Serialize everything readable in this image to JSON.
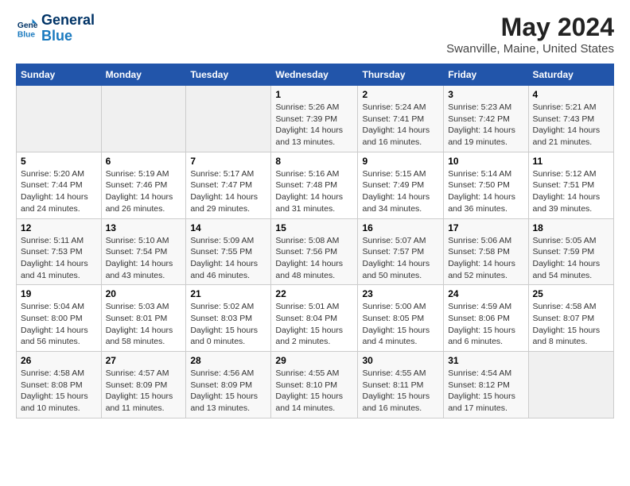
{
  "header": {
    "logo_line1": "General",
    "logo_line2": "Blue",
    "title": "May 2024",
    "subtitle": "Swanville, Maine, United States"
  },
  "columns": [
    "Sunday",
    "Monday",
    "Tuesday",
    "Wednesday",
    "Thursday",
    "Friday",
    "Saturday"
  ],
  "weeks": [
    [
      {
        "day": "",
        "info": ""
      },
      {
        "day": "",
        "info": ""
      },
      {
        "day": "",
        "info": ""
      },
      {
        "day": "1",
        "info": "Sunrise: 5:26 AM\nSunset: 7:39 PM\nDaylight: 14 hours\nand 13 minutes."
      },
      {
        "day": "2",
        "info": "Sunrise: 5:24 AM\nSunset: 7:41 PM\nDaylight: 14 hours\nand 16 minutes."
      },
      {
        "day": "3",
        "info": "Sunrise: 5:23 AM\nSunset: 7:42 PM\nDaylight: 14 hours\nand 19 minutes."
      },
      {
        "day": "4",
        "info": "Sunrise: 5:21 AM\nSunset: 7:43 PM\nDaylight: 14 hours\nand 21 minutes."
      }
    ],
    [
      {
        "day": "5",
        "info": "Sunrise: 5:20 AM\nSunset: 7:44 PM\nDaylight: 14 hours\nand 24 minutes."
      },
      {
        "day": "6",
        "info": "Sunrise: 5:19 AM\nSunset: 7:46 PM\nDaylight: 14 hours\nand 26 minutes."
      },
      {
        "day": "7",
        "info": "Sunrise: 5:17 AM\nSunset: 7:47 PM\nDaylight: 14 hours\nand 29 minutes."
      },
      {
        "day": "8",
        "info": "Sunrise: 5:16 AM\nSunset: 7:48 PM\nDaylight: 14 hours\nand 31 minutes."
      },
      {
        "day": "9",
        "info": "Sunrise: 5:15 AM\nSunset: 7:49 PM\nDaylight: 14 hours\nand 34 minutes."
      },
      {
        "day": "10",
        "info": "Sunrise: 5:14 AM\nSunset: 7:50 PM\nDaylight: 14 hours\nand 36 minutes."
      },
      {
        "day": "11",
        "info": "Sunrise: 5:12 AM\nSunset: 7:51 PM\nDaylight: 14 hours\nand 39 minutes."
      }
    ],
    [
      {
        "day": "12",
        "info": "Sunrise: 5:11 AM\nSunset: 7:53 PM\nDaylight: 14 hours\nand 41 minutes."
      },
      {
        "day": "13",
        "info": "Sunrise: 5:10 AM\nSunset: 7:54 PM\nDaylight: 14 hours\nand 43 minutes."
      },
      {
        "day": "14",
        "info": "Sunrise: 5:09 AM\nSunset: 7:55 PM\nDaylight: 14 hours\nand 46 minutes."
      },
      {
        "day": "15",
        "info": "Sunrise: 5:08 AM\nSunset: 7:56 PM\nDaylight: 14 hours\nand 48 minutes."
      },
      {
        "day": "16",
        "info": "Sunrise: 5:07 AM\nSunset: 7:57 PM\nDaylight: 14 hours\nand 50 minutes."
      },
      {
        "day": "17",
        "info": "Sunrise: 5:06 AM\nSunset: 7:58 PM\nDaylight: 14 hours\nand 52 minutes."
      },
      {
        "day": "18",
        "info": "Sunrise: 5:05 AM\nSunset: 7:59 PM\nDaylight: 14 hours\nand 54 minutes."
      }
    ],
    [
      {
        "day": "19",
        "info": "Sunrise: 5:04 AM\nSunset: 8:00 PM\nDaylight: 14 hours\nand 56 minutes."
      },
      {
        "day": "20",
        "info": "Sunrise: 5:03 AM\nSunset: 8:01 PM\nDaylight: 14 hours\nand 58 minutes."
      },
      {
        "day": "21",
        "info": "Sunrise: 5:02 AM\nSunset: 8:03 PM\nDaylight: 15 hours\nand 0 minutes."
      },
      {
        "day": "22",
        "info": "Sunrise: 5:01 AM\nSunset: 8:04 PM\nDaylight: 15 hours\nand 2 minutes."
      },
      {
        "day": "23",
        "info": "Sunrise: 5:00 AM\nSunset: 8:05 PM\nDaylight: 15 hours\nand 4 minutes."
      },
      {
        "day": "24",
        "info": "Sunrise: 4:59 AM\nSunset: 8:06 PM\nDaylight: 15 hours\nand 6 minutes."
      },
      {
        "day": "25",
        "info": "Sunrise: 4:58 AM\nSunset: 8:07 PM\nDaylight: 15 hours\nand 8 minutes."
      }
    ],
    [
      {
        "day": "26",
        "info": "Sunrise: 4:58 AM\nSunset: 8:08 PM\nDaylight: 15 hours\nand 10 minutes."
      },
      {
        "day": "27",
        "info": "Sunrise: 4:57 AM\nSunset: 8:09 PM\nDaylight: 15 hours\nand 11 minutes."
      },
      {
        "day": "28",
        "info": "Sunrise: 4:56 AM\nSunset: 8:09 PM\nDaylight: 15 hours\nand 13 minutes."
      },
      {
        "day": "29",
        "info": "Sunrise: 4:55 AM\nSunset: 8:10 PM\nDaylight: 15 hours\nand 14 minutes."
      },
      {
        "day": "30",
        "info": "Sunrise: 4:55 AM\nSunset: 8:11 PM\nDaylight: 15 hours\nand 16 minutes."
      },
      {
        "day": "31",
        "info": "Sunrise: 4:54 AM\nSunset: 8:12 PM\nDaylight: 15 hours\nand 17 minutes."
      },
      {
        "day": "",
        "info": ""
      }
    ]
  ]
}
